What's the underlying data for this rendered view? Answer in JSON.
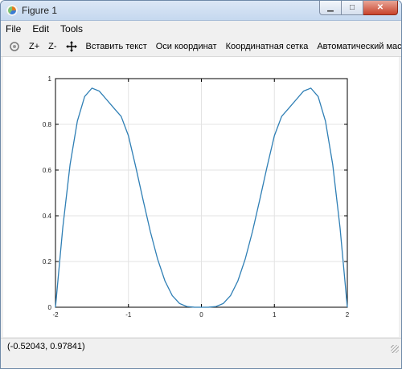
{
  "window": {
    "title": "Figure 1"
  },
  "menu": {
    "file": "File",
    "edit": "Edit",
    "tools": "Tools"
  },
  "toolbar": {
    "zoom_in": "Z+",
    "zoom_out": "Z-",
    "insert_text": "Вставить текст",
    "axes": "Оси координат",
    "grid": "Координатная сетка",
    "autoscale": "Автоматический масштаб"
  },
  "status": {
    "coords": "(-0.52043, 0.97841)"
  },
  "chart_data": {
    "type": "line",
    "line_color": "#2f7fb5",
    "grid": true,
    "xlim": [
      -2,
      2
    ],
    "ylim": [
      0,
      1
    ],
    "xticks": [
      "-2",
      "-1",
      "0",
      "1",
      "2"
    ],
    "yticks": [
      "0",
      "0.2",
      "0.4",
      "0.6",
      "0.8",
      "1"
    ],
    "x": [
      -2.0,
      -1.9,
      -1.8,
      -1.7,
      -1.6,
      -1.5,
      -1.4,
      -1.3,
      -1.2,
      -1.1,
      -1.0,
      -0.9,
      -0.8,
      -0.7,
      -0.6,
      -0.5,
      -0.4,
      -0.3,
      -0.2,
      -0.1,
      0.0,
      0.1,
      0.2,
      0.3,
      0.4,
      0.5,
      0.6,
      0.7,
      0.8,
      0.9,
      1.0,
      1.1,
      1.2,
      1.3,
      1.4,
      1.5,
      1.6,
      1.7,
      1.8,
      1.9,
      2.0
    ],
    "y": [
      0.0,
      0.3479,
      0.6236,
      0.8142,
      0.9216,
      0.9583,
      0.9455,
      0.9083,
      0.8714,
      0.8349,
      0.75,
      0.6143,
      0.4704,
      0.3312,
      0.2101,
      0.1154,
      0.0512,
      0.0164,
      0.0031,
      0.0002,
      0.0,
      0.0002,
      0.0031,
      0.0164,
      0.0512,
      0.1154,
      0.2101,
      0.3312,
      0.4704,
      0.6143,
      0.75,
      0.8349,
      0.8714,
      0.9083,
      0.9455,
      0.9583,
      0.9216,
      0.8142,
      0.6236,
      0.3479,
      0.0
    ]
  }
}
